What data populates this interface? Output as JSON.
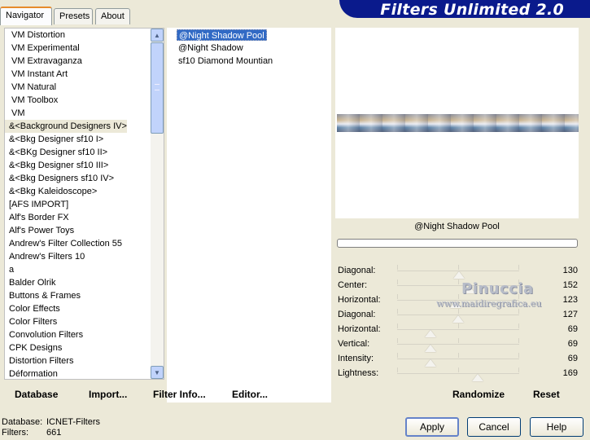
{
  "app": {
    "title": "Filters Unlimited 2.0"
  },
  "tabs": [
    {
      "label": "Navigator",
      "active": true
    },
    {
      "label": "Presets",
      "active": false
    },
    {
      "label": "About",
      "active": false
    }
  ],
  "categories": {
    "items": [
      "VM Distortion",
      "VM Experimental",
      "VM Extravaganza",
      "VM Instant Art",
      "VM Natural",
      "VM Toolbox",
      "VM",
      "&<Background Designers IV>",
      "&<Bkg Designer sf10 I>",
      "&<BKg Designer sf10 II>",
      "&<Bkg Designer sf10 III>",
      "&<Bkg Designers sf10 IV>",
      "&<Bkg Kaleidoscope>",
      "[AFS IMPORT]",
      "Alf's Border FX",
      "Alf's Power Toys",
      "Andrew's Filter Collection 55",
      "Andrew's Filters 10",
      "a",
      "Balder Olrik",
      "Buttons & Frames",
      "Color Effects",
      "Color Filters",
      "Convolution Filters",
      "CPK Designs",
      "Distortion Filters",
      "Déformation"
    ],
    "selected_index": 7
  },
  "filters": {
    "items": [
      "@Night Shadow Pool",
      "@Night Shadow",
      "sf10 Diamond Mountian"
    ],
    "selected_index": 0
  },
  "preview": {
    "current_filter": "@Night Shadow Pool"
  },
  "sliders": [
    {
      "label": "Diagonal:",
      "value": "130"
    },
    {
      "label": "Center:",
      "value": "152"
    },
    {
      "label": "Horizontal:",
      "value": "123"
    },
    {
      "label": "Diagonal:",
      "value": "127"
    },
    {
      "label": "Horizontal:",
      "value": "69"
    },
    {
      "label": "Vertical:",
      "value": "69"
    },
    {
      "label": "Intensity:",
      "value": "69"
    },
    {
      "label": "Lightness:",
      "value": "169"
    }
  ],
  "slider_max": 255,
  "watermark": {
    "line1": "Pinuccia",
    "line2": "www.maidiregrafica.eu"
  },
  "toolbar": {
    "database": "Database",
    "import": "Import...",
    "filter_info": "Filter Info...",
    "editor": "Editor...",
    "randomize": "Randomize",
    "reset": "Reset"
  },
  "status": {
    "database_label": "Database:",
    "database_value": "ICNET-Filters",
    "filters_label": "Filters:",
    "filters_value": "661"
  },
  "buttons": {
    "apply": "Apply",
    "cancel": "Cancel",
    "help": "Help"
  }
}
